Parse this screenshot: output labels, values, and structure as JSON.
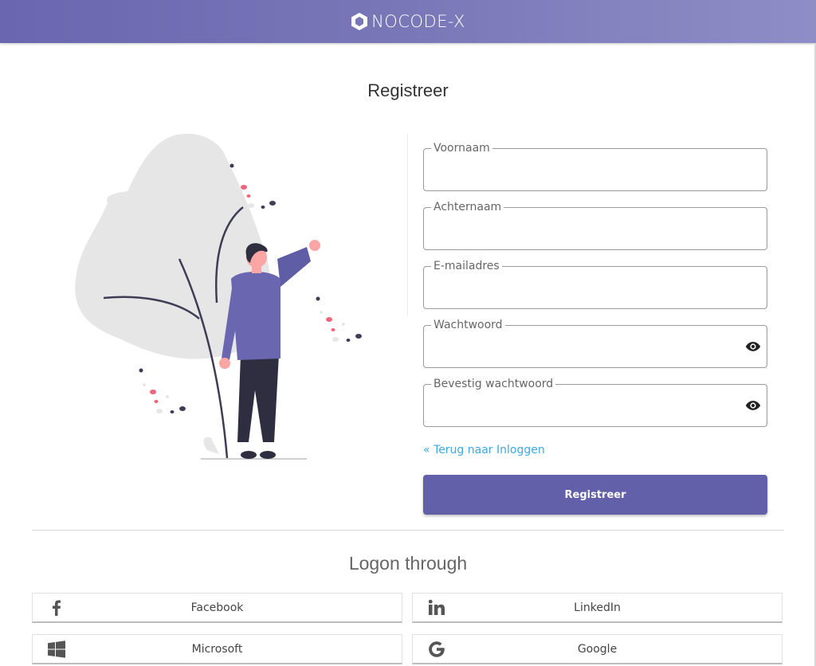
{
  "header": {
    "brand": "NOCODE-X"
  },
  "page": {
    "title": "Registreer"
  },
  "form": {
    "fields": [
      {
        "label": "Voornaam",
        "value": ""
      },
      {
        "label": "Achternaam",
        "value": ""
      },
      {
        "label": "E-mailadres",
        "value": ""
      },
      {
        "label": "Wachtwoord",
        "value": ""
      },
      {
        "label": "Bevestig wachtwoord",
        "value": ""
      }
    ],
    "back_link": "« Terug naar Inloggen",
    "submit_label": "Registreer"
  },
  "logon": {
    "title": "Logon through",
    "providers": [
      {
        "label": "Facebook",
        "icon": "facebook-icon"
      },
      {
        "label": "LinkedIn",
        "icon": "linkedin-icon"
      },
      {
        "label": "Microsoft",
        "icon": "windows-icon"
      },
      {
        "label": "Google",
        "icon": "google-icon"
      }
    ]
  },
  "colors": {
    "header": "#6a66b0",
    "primary": "#6260a8",
    "link": "#3fa8e6",
    "accent_pink": "#f0637b"
  }
}
